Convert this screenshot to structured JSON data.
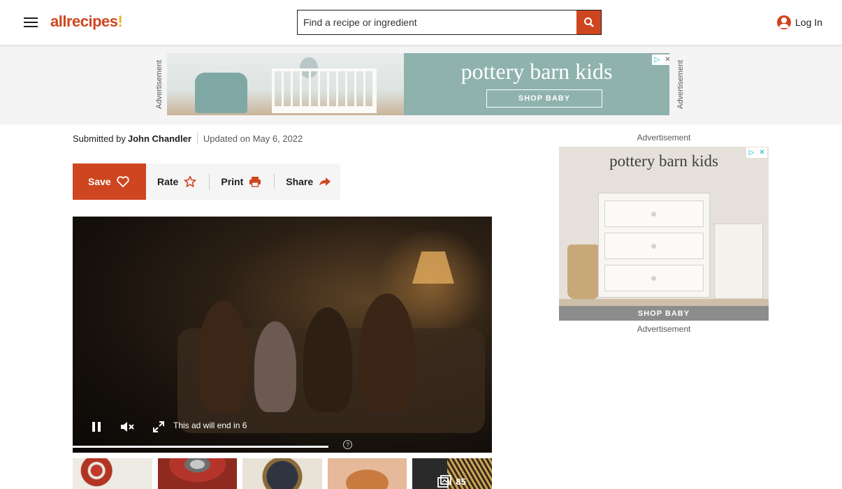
{
  "header": {
    "logo": "allrecipes",
    "search_placeholder": "Find a recipe or ingredient",
    "login_label": "Log In"
  },
  "top_ad": {
    "side_label": "Advertisement",
    "brand": "pottery barn kids",
    "cta": "SHOP BABY"
  },
  "byline": {
    "submitted_by": "Submitted by",
    "author": "John Chandler",
    "updated": "Updated on May 6, 2022"
  },
  "actions": {
    "save": "Save",
    "rate": "Rate",
    "print": "Print",
    "share": "Share"
  },
  "video": {
    "ad_timer": "This ad will end in 6",
    "progress": 0.61
  },
  "gallery": {
    "photo_count": "85"
  },
  "rail_ad": {
    "label_top": "Advertisement",
    "label_bottom": "Advertisement",
    "brand": "pottery barn kids",
    "cta": "SHOP BABY"
  },
  "colors": {
    "brand_orange": "#ce4620",
    "brand_yellow": "#f2b422"
  }
}
